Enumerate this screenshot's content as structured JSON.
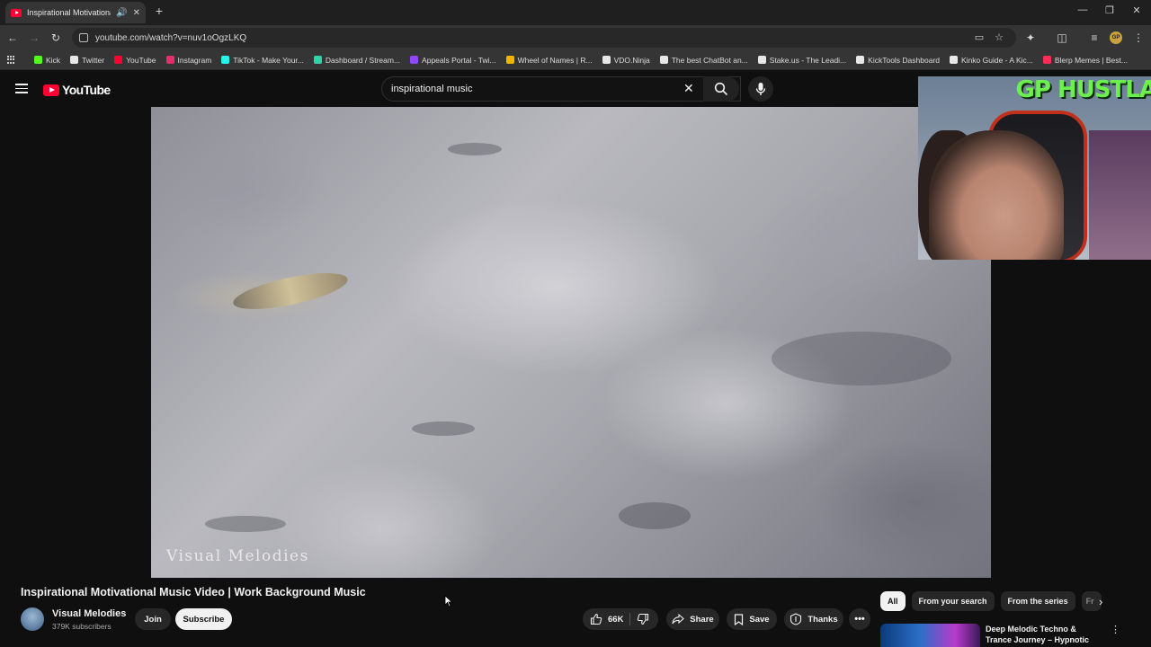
{
  "browser": {
    "tab_title": "Inspirational Motivational Music Video | Work Background Music",
    "url": "youtube.com/watch?v=nuv1oOgzLKQ",
    "profile_initials": "GP",
    "bookmarks": [
      {
        "label": "Kick",
        "color": "#53fc18"
      },
      {
        "label": "Twitter",
        "color": "#e7e7e7"
      },
      {
        "label": "YouTube",
        "color": "#ff0033"
      },
      {
        "label": "Instagram",
        "color": "#e1306c"
      },
      {
        "label": "TikTok - Make Your...",
        "color": "#25f4ee"
      },
      {
        "label": "Dashboard / Stream...",
        "color": "#2ed3a8"
      },
      {
        "label": "Appeals Portal - Twi...",
        "color": "#9146ff"
      },
      {
        "label": "Wheel of Names | R...",
        "color": "#f4b400"
      },
      {
        "label": "VDO.Ninja",
        "color": "#e7e7e7"
      },
      {
        "label": "The best ChatBot an...",
        "color": "#e7e7e7"
      },
      {
        "label": "Stake.us - The Leadi...",
        "color": "#e7e7e7"
      },
      {
        "label": "KickTools Dashboard",
        "color": "#e7e7e7"
      },
      {
        "label": "Kinko Guide - A Kic...",
        "color": "#e7e7e7"
      },
      {
        "label": "Blerp Memes | Best...",
        "color": "#ff2d55"
      }
    ]
  },
  "masthead": {
    "logo_text": "YouTube",
    "search_query": "inspirational music"
  },
  "video": {
    "watermark": "Visual Melodies",
    "webcam_overlay": "GP HUSTLA",
    "title": "Inspirational Motivational Music Video | Work Background Music",
    "channel": "Visual Melodies",
    "subscribers": "379K subscribers",
    "join_label": "Join",
    "subscribe_label": "Subscribe",
    "likes": "66K",
    "share_label": "Share",
    "save_label": "Save",
    "thanks_label": "Thanks"
  },
  "sidebar": {
    "chips": [
      "All",
      "From your search",
      "From the series",
      "Fr"
    ],
    "recommendation_title": "Deep Melodic Techno & Trance Journey – Hypnotic Mix for ..."
  },
  "colors": {
    "brand_red": "#ff0033",
    "background": "#0f0f0f",
    "overlay_green": "#6cf04d"
  }
}
